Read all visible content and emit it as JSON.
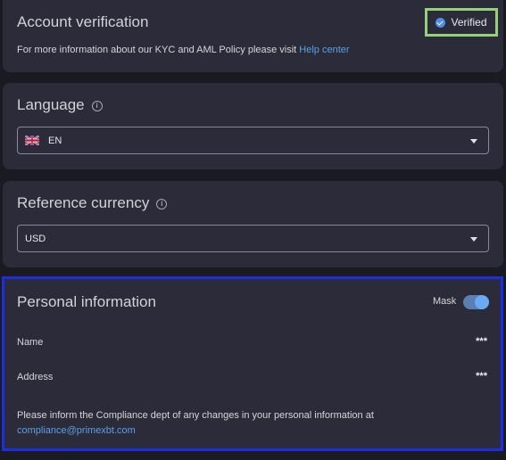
{
  "account": {
    "title": "Account verification",
    "status_label": "Verified",
    "info_prefix": "For more information about our KYC and AML Policy please visit ",
    "help_link": "Help center"
  },
  "language": {
    "title": "Language",
    "value": "EN",
    "icon": "uk-flag-icon"
  },
  "currency": {
    "title": "Reference currency",
    "value": "USD"
  },
  "personal": {
    "title": "Personal information",
    "mask_label": "Mask",
    "mask_on": true,
    "name_label": "Name",
    "name_value": "***",
    "address_label": "Address",
    "address_value": "***",
    "notice": "Please inform the Compliance dept of any changes in your personal information at",
    "email": "compliance@primexbt.com"
  },
  "colors": {
    "verified_outline": "#94d27a",
    "highlight_outline": "#1d2ee0",
    "accent": "#5aa0ea"
  }
}
